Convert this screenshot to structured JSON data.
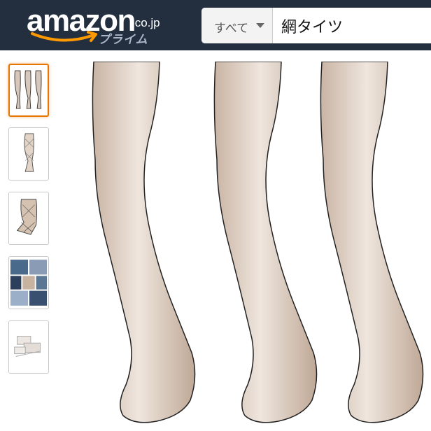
{
  "header": {
    "logo_word": "amazon",
    "logo_tld": ".co.jp",
    "logo_sub": "プライム",
    "bg_color": "#232f3e",
    "accent_color": "#ff9900"
  },
  "search": {
    "department": "すべて",
    "department_icon": "caret-down-icon",
    "query": "網タイツ"
  },
  "thumbnails": [
    {
      "label": "three-pairs-view",
      "selected": true
    },
    {
      "label": "single-leg-view",
      "selected": false
    },
    {
      "label": "foot-closeup-view",
      "selected": false
    },
    {
      "label": "lifestyle-collage-view",
      "selected": false
    },
    {
      "label": "package-contents-view",
      "selected": false
    }
  ],
  "main_image": {
    "subject": "three black fishnet tights on leg forms",
    "selected_color": "#e77600"
  }
}
